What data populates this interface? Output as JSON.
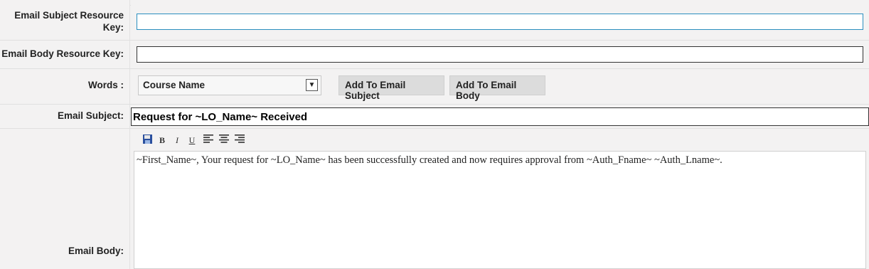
{
  "fields": {
    "subject_key_label": "Email Subject Resource Key:",
    "subject_key_value": "",
    "body_key_label": "Email Body Resource Key:",
    "body_key_value": "",
    "words_label": "Words :",
    "words_selected": "Course Name",
    "add_subject_button": "Add To Email Subject",
    "add_body_button": "Add To Email Body",
    "email_subject_label": "Email Subject:",
    "email_subject_value": "Request for ~LO_Name~ Received",
    "email_body_label": "Email Body:",
    "email_body_text": "~First_Name~, Your request for ~LO_Name~ has been successfully created and now requires approval from ~Auth_Fname~ ~Auth_Lname~."
  },
  "toolbar": {
    "bold": "B",
    "italic": "I",
    "underline": "U"
  },
  "icons": [
    "save-icon",
    "bold-icon",
    "italic-icon",
    "underline-icon",
    "align-left-icon",
    "align-center-icon",
    "align-right-icon",
    "chevron-down-icon"
  ]
}
